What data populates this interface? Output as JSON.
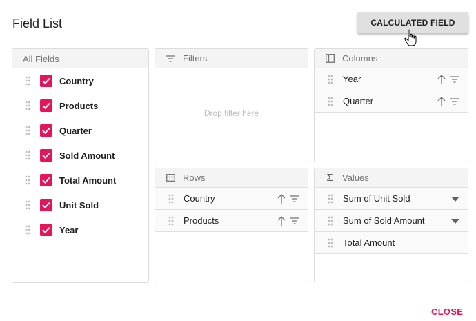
{
  "dialog": {
    "title": "Field List",
    "calculated_field_label": "CALCULATED FIELD",
    "close_label": "CLOSE"
  },
  "all_fields": {
    "header": "All Fields",
    "items": [
      {
        "label": "Country",
        "checked": true
      },
      {
        "label": "Products",
        "checked": true
      },
      {
        "label": "Quarter",
        "checked": true
      },
      {
        "label": "Sold Amount",
        "checked": true
      },
      {
        "label": "Total Amount",
        "checked": true
      },
      {
        "label": "Unit Sold",
        "checked": true
      },
      {
        "label": "Year",
        "checked": true
      }
    ]
  },
  "filters": {
    "header": "Filters",
    "placeholder": "Drop filter here",
    "icon": "filter-icon"
  },
  "columns": {
    "header": "Columns",
    "icon": "columns-icon",
    "items": [
      {
        "label": "Year"
      },
      {
        "label": "Quarter"
      }
    ]
  },
  "rows": {
    "header": "Rows",
    "icon": "rows-icon",
    "items": [
      {
        "label": "Country"
      },
      {
        "label": "Products"
      }
    ]
  },
  "values": {
    "header": "Values",
    "icon": "sigma-icon",
    "items": [
      {
        "label": "Sum of Unit Sold",
        "has_dropdown": true
      },
      {
        "label": "Sum of Sold Amount",
        "has_dropdown": true
      },
      {
        "label": "Total Amount",
        "has_dropdown": false
      }
    ]
  },
  "colors": {
    "accent": "#e3165b",
    "header_bg": "#f4f4f4",
    "border": "#dcdcdc"
  }
}
